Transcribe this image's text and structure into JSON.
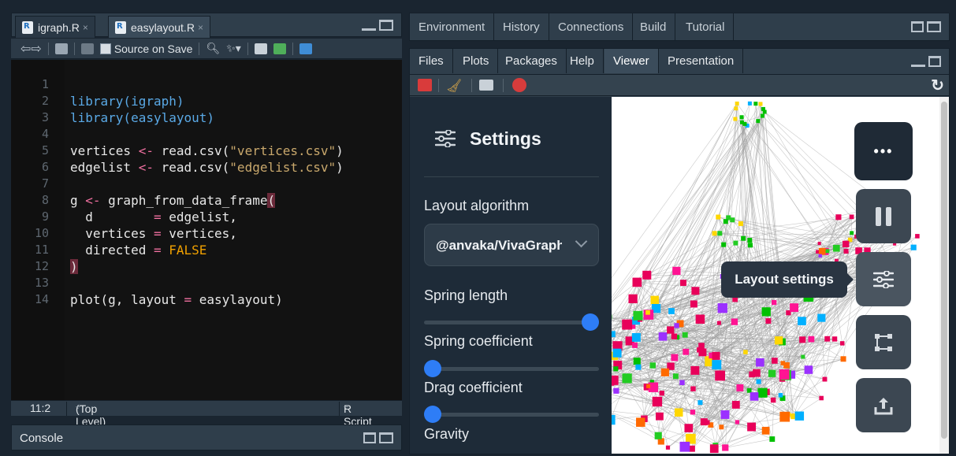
{
  "editor": {
    "tabs": [
      {
        "label": "igraph.R",
        "close": "×"
      },
      {
        "label": "easylayout.R",
        "close": "×"
      }
    ],
    "toolbar": {
      "source_on_save": "Source on Save"
    },
    "lines": [
      {
        "n": "1"
      },
      {
        "n": "2"
      },
      {
        "n": "3"
      },
      {
        "n": "4"
      },
      {
        "n": "5"
      },
      {
        "n": "6"
      },
      {
        "n": "7"
      },
      {
        "n": "8"
      },
      {
        "n": "9"
      },
      {
        "n": "10"
      },
      {
        "n": "11"
      },
      {
        "n": "12"
      },
      {
        "n": "13"
      },
      {
        "n": "14"
      }
    ],
    "code": {
      "l1": [
        "library(",
        "igraph",
        ")"
      ],
      "l2": [
        "library(",
        "easylayout",
        ")"
      ],
      "l4": [
        "vertices ",
        "<-",
        " read.csv(",
        "\"vertices.csv\"",
        ")"
      ],
      "l5": [
        "edgelist ",
        "<-",
        " read.csv(",
        "\"edgelist.csv\"",
        ")"
      ],
      "l7": [
        "g ",
        "<-",
        " graph_from_data_frame",
        "("
      ],
      "l8": [
        "  d        ",
        "=",
        " edgelist,"
      ],
      "l9": [
        "  vertices ",
        "=",
        " vertices,"
      ],
      "l10": [
        "  directed ",
        "=",
        " FALSE"
      ],
      "l11": [
        ")"
      ],
      "l13": [
        "plot(g, layout ",
        "=",
        " easylayout)"
      ]
    },
    "status": {
      "position": "11:2",
      "scope": "(Top Level)",
      "scope_arrow": "÷",
      "filetype": "R Script",
      "filetype_arrow": "÷"
    }
  },
  "console": {
    "label": "Console"
  },
  "top_right_tabs": [
    "Environment",
    "History",
    "Connections",
    "Build",
    "Tutorial"
  ],
  "bottom_right_tabs": [
    "Files",
    "Plots",
    "Packages",
    "Help",
    "Viewer",
    "Presentation"
  ],
  "active_bottom_tab": "Viewer",
  "settings": {
    "title": "Settings",
    "layout_algorithm_label": "Layout algorithm",
    "layout_algorithm_value": "@anvaka/VivaGraphJS",
    "spring_length_label": "Spring length",
    "spring_length_value": 1.0,
    "spring_coefficient_label": "Spring coefficient",
    "spring_coefficient_value": 0.0,
    "drag_coefficient_label": "Drag coefficient",
    "drag_coefficient_value": 0.0,
    "gravity_label": "Gravity"
  },
  "viewer": {
    "more_label": "•••",
    "tooltip": "Layout settings",
    "buttons": [
      "more-options",
      "pause",
      "layout-settings",
      "fit-graph",
      "export"
    ]
  },
  "colors": {
    "accent": "#2e7df6",
    "editor_bg": "#121212",
    "keyword": "#5aa9e6",
    "string": "#c9a86c",
    "operator": "#f070a0",
    "boolean": "#f0a000",
    "panel": "#2f3e4b"
  }
}
